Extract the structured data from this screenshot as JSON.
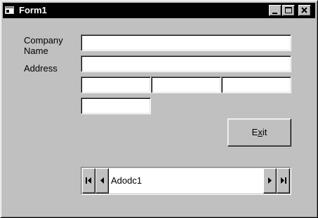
{
  "window": {
    "title": "Form1",
    "minimize_icon": "minimize-icon",
    "maximize_icon": "maximize-icon",
    "close_icon": "close-icon"
  },
  "form": {
    "company_label": "Company\nName",
    "address_label": "Address",
    "company_name_value": "",
    "address_value": "",
    "city_value": "",
    "state_value": "",
    "zip_value": "",
    "phone_value": ""
  },
  "exit_button": {
    "label_pre": "E",
    "label_access": "x",
    "label_post": "it"
  },
  "adodc": {
    "caption": "Adodc1",
    "icons": [
      "first-record-icon",
      "previous-record-icon",
      "next-record-icon",
      "last-record-icon"
    ]
  }
}
